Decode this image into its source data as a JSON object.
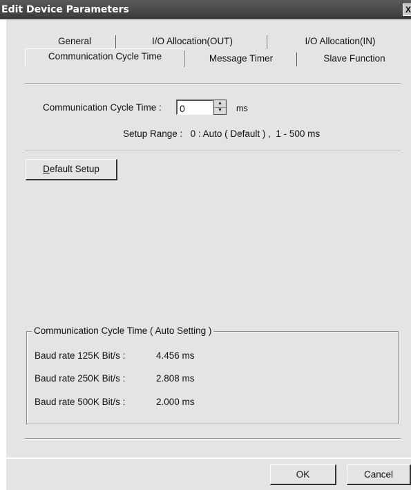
{
  "window": {
    "title": "Edit Device Parameters",
    "close_glyph": "X"
  },
  "tabs_row1": [
    "General",
    "I/O Allocation(OUT)",
    "I/O Allocation(IN)"
  ],
  "tabs_row2": [
    "Communication Cycle Time",
    "Message Timer",
    "Slave Function"
  ],
  "active_tab": "Communication Cycle Time",
  "cycle_time": {
    "label": "Communication Cycle Time :",
    "value": "0",
    "unit": "ms",
    "range_text": "Setup Range :   0 : Auto ( Default ) ,  1 - 500 ms",
    "spin_up_glyph": "▲",
    "spin_down_glyph": "▼"
  },
  "default_setup": {
    "accel": "D",
    "rest": "efault Setup"
  },
  "auto_setting": {
    "title": "Communication Cycle Time ( Auto Setting )",
    "rows": [
      {
        "label": "Baud rate 125K Bit/s :",
        "value": "4.456 ms"
      },
      {
        "label": "Baud rate 250K Bit/s :",
        "value": "2.808 ms"
      },
      {
        "label": "Baud rate 500K Bit/s :",
        "value": "2.000 ms"
      }
    ]
  },
  "buttons": {
    "ok": "OK",
    "cancel": "Cancel"
  },
  "colors": {
    "dialog_bg": "#e4e4e4",
    "titlebar": "#4a4a4a"
  }
}
